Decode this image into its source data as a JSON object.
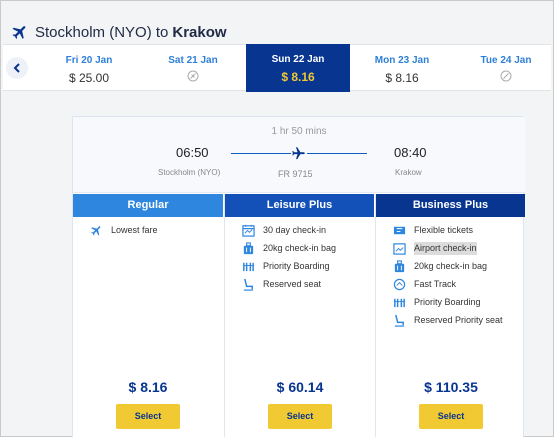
{
  "route": {
    "origin": "Stockholm (NYO) to",
    "destination": "Krakow"
  },
  "dates": [
    {
      "day": "Fri 20 Jan",
      "price": "$ 25.00",
      "available": true,
      "active": false
    },
    {
      "day": "Sat 21 Jan",
      "price": "",
      "available": false,
      "active": false
    },
    {
      "day": "Sun 22 Jan",
      "price": "$ 8.16",
      "available": true,
      "active": true
    },
    {
      "day": "Mon 23 Jan",
      "price": "$ 8.16",
      "available": true,
      "active": false
    },
    {
      "day": "Tue 24 Jan",
      "price": "",
      "available": false,
      "active": false
    }
  ],
  "flight": {
    "duration": "1 hr 50 mins",
    "dep_time": "06:50",
    "dep_city": "Stockholm (NYO)",
    "arr_time": "08:40",
    "arr_city": "Krakow",
    "flight_number": "FR 9715"
  },
  "fares": [
    {
      "name": "Regular",
      "price": "$ 8.16",
      "select_label": "Select",
      "features": [
        {
          "label": "Lowest fare",
          "icon": "plane-icon"
        }
      ]
    },
    {
      "name": "Leisure Plus",
      "price": "$ 60.14",
      "select_label": "Select",
      "features": [
        {
          "label": "30 day check-in",
          "icon": "calendar-icon"
        },
        {
          "label": "20kg check-in bag",
          "icon": "luggage-icon"
        },
        {
          "label": "Priority Boarding",
          "icon": "boarding-icon"
        },
        {
          "label": "Reserved seat",
          "icon": "seat-icon"
        }
      ]
    },
    {
      "name": "Business Plus",
      "price": "$ 110.35",
      "select_label": "Select",
      "features": [
        {
          "label": "Flexible tickets",
          "icon": "ticket-icon"
        },
        {
          "label": "Airport check-in",
          "icon": "checkin-icon"
        },
        {
          "label": "20kg check-in bag",
          "icon": "luggage-icon"
        },
        {
          "label": "Fast Track",
          "icon": "fasttrack-icon"
        },
        {
          "label": "Priority Boarding",
          "icon": "boarding-icon"
        },
        {
          "label": "Reserved Priority seat",
          "icon": "seat-icon"
        }
      ]
    }
  ],
  "colors": {
    "brand_dark": "#073590",
    "brand_mid": "#1351b8",
    "brand_light": "#2f86de",
    "accent_yellow": "#f1c933"
  }
}
